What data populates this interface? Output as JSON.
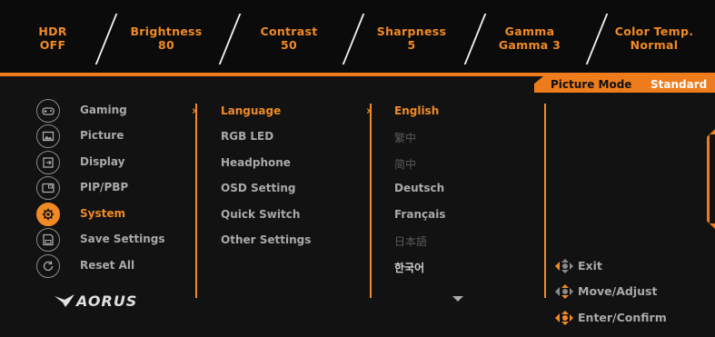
{
  "status": [
    {
      "label": "HDR",
      "value": "OFF"
    },
    {
      "label": "Brightness",
      "value": "80"
    },
    {
      "label": "Contrast",
      "value": "50"
    },
    {
      "label": "Sharpness",
      "value": "5"
    },
    {
      "label": "Gamma",
      "value": "Gamma 3"
    },
    {
      "label": "Color Temp.",
      "value": "Normal"
    }
  ],
  "picture_mode": {
    "label": "Picture Mode",
    "value": "Standard"
  },
  "main_menu": [
    {
      "label": "Gaming",
      "icon": "gamepad-icon"
    },
    {
      "label": "Picture",
      "icon": "picture-icon"
    },
    {
      "label": "Display",
      "icon": "display-icon"
    },
    {
      "label": "PIP/PBP",
      "icon": "pip-icon"
    },
    {
      "label": "System",
      "icon": "gear-icon",
      "active": true
    },
    {
      "label": "Save Settings",
      "icon": "save-icon"
    },
    {
      "label": "Reset All",
      "icon": "reset-icon"
    }
  ],
  "sub_menu": [
    "Language",
    "RGB LED",
    "Headphone",
    "OSD Setting",
    "Quick Switch",
    "Other Settings"
  ],
  "options": [
    "English",
    "繁中",
    "简中",
    "Deutsch",
    "Français",
    "日本語",
    "한국어"
  ],
  "hints": [
    {
      "label": "Exit",
      "icon": "dpad-left-icon"
    },
    {
      "label": "Move/Adjust",
      "icon": "dpad-updown-icon"
    },
    {
      "label": "Enter/Confirm",
      "icon": "dpad-press-icon"
    }
  ],
  "logo": "AORUS",
  "colors": {
    "accent": "#f08a24",
    "text": "#a9a9a9",
    "background": "#121212"
  }
}
